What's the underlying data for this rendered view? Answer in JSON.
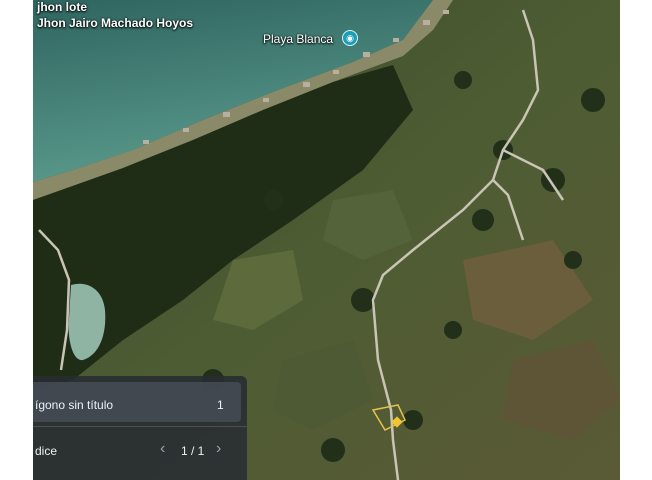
{
  "map": {
    "title": "jhon lote",
    "subtitle": "Jhon Jairo Machado Hoyos",
    "place_label": "Playa Blanca",
    "place_icon": "camera-pin-icon"
  },
  "panel": {
    "item_label": "ígono sin título",
    "item_count": "1",
    "footer_label": "dice",
    "page_indicator": "1 / 1",
    "prev_icon": "chevron-left-icon",
    "next_icon": "chevron-right-icon"
  },
  "colors": {
    "sea": "#3f7a73",
    "forest": "#26361d",
    "fields": "#5a6a3a",
    "road": "#c9c4b5",
    "panel_bg": "#282c32"
  }
}
